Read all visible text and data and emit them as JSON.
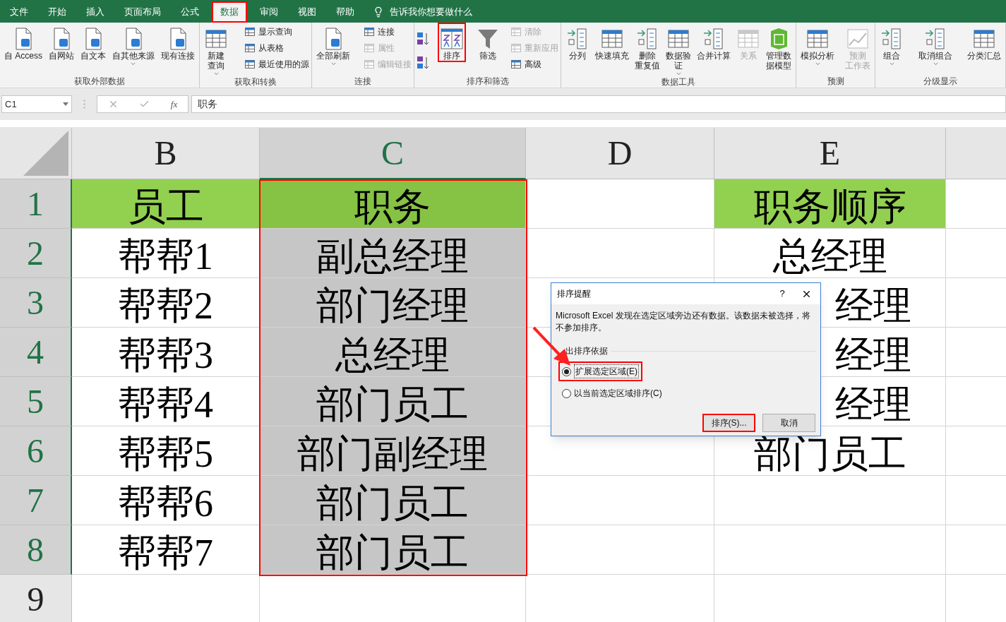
{
  "menu_tabs": [
    {
      "label": "文件",
      "selected": false,
      "highlighted": false
    },
    {
      "label": "开始",
      "selected": false,
      "highlighted": false
    },
    {
      "label": "插入",
      "selected": false,
      "highlighted": false
    },
    {
      "label": "页面布局",
      "selected": false,
      "highlighted": false
    },
    {
      "label": "公式",
      "selected": false,
      "highlighted": false
    },
    {
      "label": "数据",
      "selected": true,
      "highlighted": true
    },
    {
      "label": "审阅",
      "selected": false,
      "highlighted": false
    },
    {
      "label": "视图",
      "selected": false,
      "highlighted": false
    },
    {
      "label": "帮助",
      "selected": false,
      "highlighted": false
    }
  ],
  "tell_me": "告诉我你想要做什么",
  "ribbon_groups": [
    {
      "label": "获取外部数据",
      "items": [
        {
          "kind": "large",
          "lines": [
            "自 Access"
          ],
          "disabled": false,
          "dropdown": false,
          "highlighted": false
        },
        {
          "kind": "large",
          "lines": [
            "自网站"
          ],
          "disabled": false,
          "dropdown": false,
          "highlighted": false
        },
        {
          "kind": "large",
          "lines": [
            "自文本"
          ],
          "disabled": false,
          "dropdown": false,
          "highlighted": false
        },
        {
          "kind": "large",
          "lines": [
            "自其他来源"
          ],
          "disabled": false,
          "dropdown": true,
          "highlighted": false
        },
        {
          "kind": "large",
          "lines": [
            "现有连接"
          ],
          "disabled": false,
          "dropdown": false,
          "highlighted": false
        }
      ]
    },
    {
      "label": "获取和转换",
      "items": [
        {
          "kind": "large",
          "lines": [
            "新建",
            "查询"
          ],
          "disabled": false,
          "dropdown": true,
          "highlighted": false
        },
        {
          "kind": "stack",
          "entries": [
            {
              "label": "显示查询",
              "disabled": false
            },
            {
              "label": "从表格",
              "disabled": false
            },
            {
              "label": "最近使用的源",
              "disabled": false
            }
          ]
        }
      ]
    },
    {
      "label": "连接",
      "items": [
        {
          "kind": "large",
          "lines": [
            "全部刷新"
          ],
          "disabled": false,
          "dropdown": true,
          "highlighted": false
        },
        {
          "kind": "stack",
          "entries": [
            {
              "label": "连接",
              "disabled": false
            },
            {
              "label": "属性",
              "disabled": true
            },
            {
              "label": "编辑链接",
              "disabled": true
            }
          ]
        }
      ]
    },
    {
      "label": "排序和筛选",
      "items": [
        {
          "kind": "sortpair"
        },
        {
          "kind": "large",
          "lines": [
            "排序"
          ],
          "disabled": false,
          "dropdown": false,
          "highlighted": true
        },
        {
          "kind": "large",
          "lines": [
            "筛选"
          ],
          "disabled": false,
          "dropdown": false,
          "highlighted": false
        },
        {
          "kind": "stack",
          "entries": [
            {
              "label": "清除",
              "disabled": true
            },
            {
              "label": "重新应用",
              "disabled": true
            },
            {
              "label": "高级",
              "disabled": false
            }
          ]
        }
      ]
    },
    {
      "label": "数据工具",
      "items": [
        {
          "kind": "large",
          "lines": [
            "分列"
          ],
          "disabled": false,
          "dropdown": false,
          "highlighted": false
        },
        {
          "kind": "large",
          "lines": [
            "快速填充"
          ],
          "disabled": false,
          "dropdown": false,
          "highlighted": false
        },
        {
          "kind": "large",
          "lines": [
            "删除",
            "重复值"
          ],
          "disabled": false,
          "dropdown": false,
          "highlighted": false
        },
        {
          "kind": "large",
          "lines": [
            "数据验",
            "证"
          ],
          "disabled": false,
          "dropdown": true,
          "highlighted": false
        },
        {
          "kind": "large",
          "lines": [
            "合并计算"
          ],
          "disabled": false,
          "dropdown": false,
          "highlighted": false
        },
        {
          "kind": "large",
          "lines": [
            "关系"
          ],
          "disabled": true,
          "dropdown": false,
          "highlighted": false
        },
        {
          "kind": "large",
          "lines": [
            "管理数",
            "据模型"
          ],
          "disabled": false,
          "dropdown": false,
          "highlighted": false
        }
      ]
    },
    {
      "label": "预测",
      "items": [
        {
          "kind": "large",
          "lines": [
            "模拟分析"
          ],
          "disabled": false,
          "dropdown": true,
          "highlighted": false
        },
        {
          "kind": "large",
          "lines": [
            "预测",
            "工作表"
          ],
          "disabled": true,
          "dropdown": false,
          "highlighted": false
        }
      ]
    },
    {
      "label": "分级显示",
      "items": [
        {
          "kind": "large",
          "lines": [
            "组合"
          ],
          "disabled": false,
          "dropdown": true,
          "highlighted": false
        },
        {
          "kind": "large",
          "lines": [
            "取消组合"
          ],
          "disabled": false,
          "dropdown": true,
          "highlighted": false
        },
        {
          "kind": "large",
          "lines": [
            "分类汇总"
          ],
          "disabled": false,
          "dropdown": false,
          "highlighted": false
        }
      ]
    }
  ],
  "formula_bar": {
    "name_box": "C1",
    "function_label": "fx",
    "value": "职务"
  },
  "columns": [
    {
      "letter": "B",
      "selected": false
    },
    {
      "letter": "C",
      "selected": true
    },
    {
      "letter": "D",
      "selected": false
    },
    {
      "letter": "E",
      "selected": false
    }
  ],
  "rows": [
    {
      "number": "1",
      "selected": true,
      "cells": [
        {
          "text": "员工",
          "kind": "header",
          "selected": false
        },
        {
          "text": "职务",
          "kind": "header",
          "selected": true
        },
        {
          "kind": "plain",
          "selected": false
        },
        {
          "text": "职务顺序",
          "kind": "header",
          "selected": false,
          "clipped": false
        }
      ]
    },
    {
      "number": "2",
      "selected": true,
      "cells": [
        {
          "text": "帮帮1",
          "kind": "plain",
          "selected": false
        },
        {
          "text": "副总经理",
          "kind": "plain",
          "selected": true
        },
        {
          "kind": "plain",
          "selected": false
        },
        {
          "text": "总经理",
          "kind": "plain",
          "selected": false,
          "clipped": false
        }
      ]
    },
    {
      "number": "3",
      "selected": true,
      "cells": [
        {
          "text": "帮帮2",
          "kind": "plain",
          "selected": false
        },
        {
          "text": "部门经理",
          "kind": "plain",
          "selected": true
        },
        {
          "kind": "plain",
          "selected": false
        },
        {
          "text": "经理",
          "kind": "plain",
          "selected": false,
          "clipped": true
        }
      ]
    },
    {
      "number": "4",
      "selected": true,
      "cells": [
        {
          "text": "帮帮3",
          "kind": "plain",
          "selected": false
        },
        {
          "text": "总经理",
          "kind": "plain",
          "selected": true
        },
        {
          "kind": "plain",
          "selected": false
        },
        {
          "text": "经理",
          "kind": "plain",
          "selected": false,
          "clipped": true
        }
      ]
    },
    {
      "number": "5",
      "selected": true,
      "cells": [
        {
          "text": "帮帮4",
          "kind": "plain",
          "selected": false
        },
        {
          "text": "部门员工",
          "kind": "plain",
          "selected": true
        },
        {
          "kind": "plain",
          "selected": false
        },
        {
          "text": "经理",
          "kind": "plain",
          "selected": false,
          "clipped": true
        }
      ]
    },
    {
      "number": "6",
      "selected": true,
      "cells": [
        {
          "text": "帮帮5",
          "kind": "plain",
          "selected": false
        },
        {
          "text": "部门副经理",
          "kind": "plain",
          "selected": true
        },
        {
          "kind": "plain",
          "selected": false
        },
        {
          "text": "部门员工",
          "kind": "plain",
          "selected": false,
          "clipped": false
        }
      ]
    },
    {
      "number": "7",
      "selected": true,
      "cells": [
        {
          "text": "帮帮6",
          "kind": "plain",
          "selected": false
        },
        {
          "text": "部门员工",
          "kind": "plain",
          "selected": true
        },
        {
          "kind": "plain",
          "selected": false
        },
        {
          "kind": "plain",
          "selected": false
        }
      ]
    },
    {
      "number": "8",
      "selected": true,
      "cells": [
        {
          "text": "帮帮7",
          "kind": "plain",
          "selected": false
        },
        {
          "text": "部门员工",
          "kind": "plain",
          "selected": true
        },
        {
          "kind": "plain",
          "selected": false
        },
        {
          "kind": "plain",
          "selected": false
        }
      ]
    },
    {
      "number": "9",
      "selected": false,
      "cells": [
        {
          "kind": "plain",
          "selected": false
        },
        {
          "kind": "plain",
          "selected": false
        },
        {
          "kind": "plain",
          "selected": false
        },
        {
          "kind": "plain",
          "selected": false
        }
      ]
    }
  ],
  "dialog": {
    "title": "排序提醒",
    "help": "?",
    "message": "Microsoft Excel 发现在选定区域旁边还有数据。该数据未被选择，将不参加排序。",
    "group_label": "出排序依据",
    "options": [
      {
        "label": "扩展选定区域(E)",
        "selected": true,
        "highlighted": true
      },
      {
        "label": "以当前选定区域排序(C)",
        "selected": false,
        "highlighted": false
      }
    ],
    "buttons": [
      {
        "label": "排序(S)...",
        "highlighted": true
      },
      {
        "label": "取消",
        "highlighted": false
      }
    ]
  }
}
